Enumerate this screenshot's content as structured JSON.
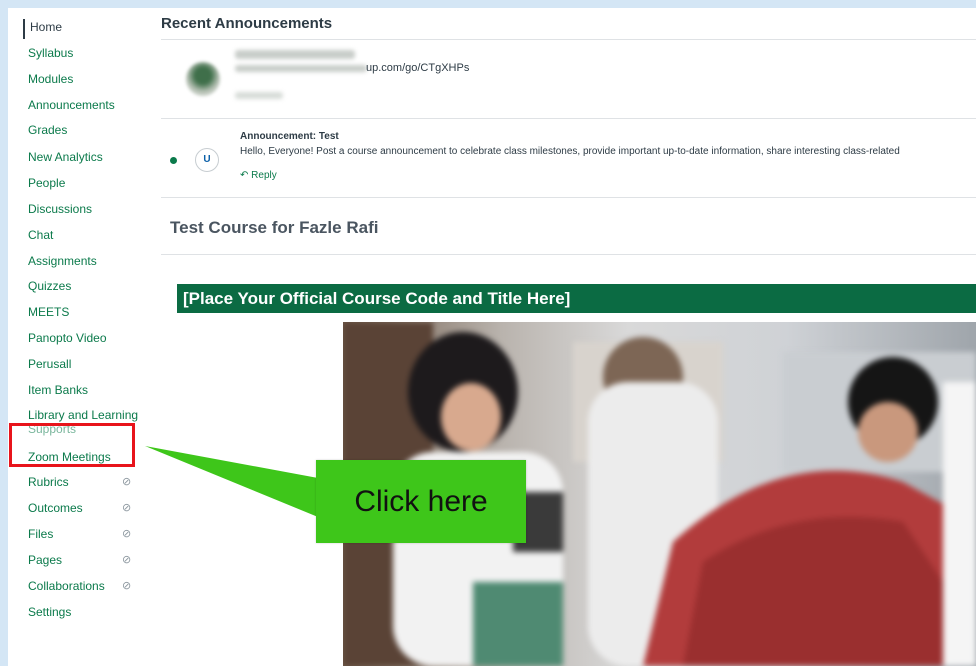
{
  "nav": {
    "items": [
      {
        "label": "Home"
      },
      {
        "label": "Syllabus"
      },
      {
        "label": "Modules"
      },
      {
        "label": "Announcements"
      },
      {
        "label": "Grades"
      },
      {
        "label": "New Analytics"
      },
      {
        "label": "People"
      },
      {
        "label": "Discussions"
      },
      {
        "label": "Chat"
      },
      {
        "label": "Assignments"
      },
      {
        "label": "Quizzes"
      },
      {
        "label": "MEETS"
      },
      {
        "label": "Panopto Video"
      },
      {
        "label": "Perusall"
      },
      {
        "label": "Item Banks"
      },
      {
        "label": "Library and Learning",
        "label2": "Supports"
      },
      {
        "label": "Zoom Meetings"
      },
      {
        "label": "Rubrics"
      },
      {
        "label": "Outcomes"
      },
      {
        "label": "Files"
      },
      {
        "label": "Pages"
      },
      {
        "label": "Collaborations"
      },
      {
        "label": "Settings"
      }
    ],
    "hidden_icon": "eye-slash-icon"
  },
  "announcements": {
    "section_title": "Recent Announcements",
    "items": [
      {
        "link_text": "up.com/go/CTgXHPs"
      },
      {
        "avatar_initial": "U",
        "title": "Announcement: Test",
        "body": "Hello, Everyone! Post a course announcement to celebrate class milestones, provide important up-to-date information, share interesting class-related",
        "reply_label": "Reply"
      }
    ]
  },
  "course": {
    "title": "Test Course for Fazle Rafi",
    "banner": "[Place Your Official Course Code and Title Here]"
  },
  "callout": {
    "label": "Click here",
    "color": "#3ec61a",
    "highlight_color": "#e8141b"
  }
}
